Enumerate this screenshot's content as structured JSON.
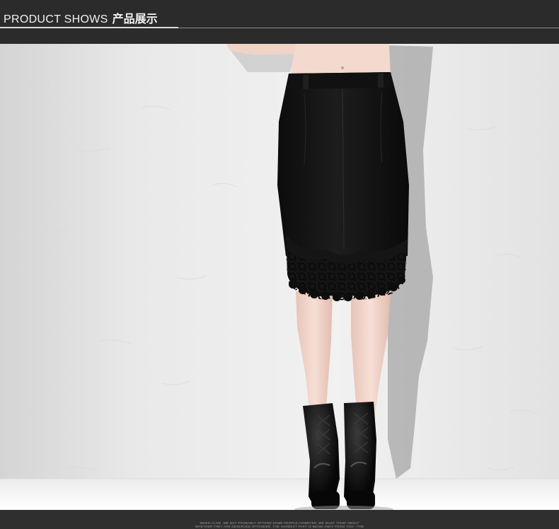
{
  "header": {
    "title_en": "PRODUCT SHOWS",
    "title_zh": "产品展示"
  },
  "photo": {
    "subject": "black knee-length pencil skirt with lace hem, worn with black lace-up platform ankle boots",
    "colors": {
      "wall": "#ececec",
      "skirt": "#141414",
      "skin": "#f1d6cb",
      "shadow": "#8c8c8c"
    }
  },
  "footer": {
    "line1": "WHEN ALIVE ,WE MAY PROBABLY OFFEND SOME PEOPLE.HOWEVER, WE MUST THINK ABOUT",
    "line2": "WHETHER THEY ARE DESERVED OFFENDED. THE HARDEST PART IS BEING AWAY FROM YOU---THE"
  }
}
